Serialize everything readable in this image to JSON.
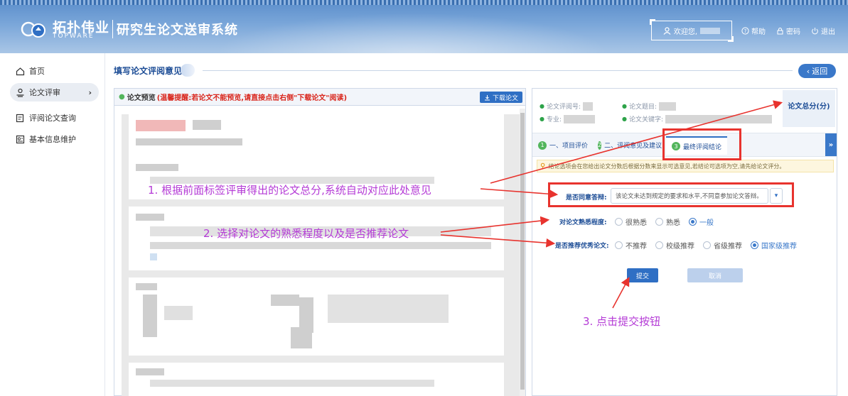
{
  "header": {
    "logo_cn": "拓扑伟业",
    "logo_en": "TOPWARE",
    "app_title": "研究生论文送审系统",
    "welcome": "欢迎您,",
    "links": [
      {
        "label": "帮助",
        "icon": "help-circle-icon"
      },
      {
        "label": "密码",
        "icon": "lock-icon"
      },
      {
        "label": "退出",
        "icon": "power-icon"
      }
    ]
  },
  "sidebar": {
    "items": [
      {
        "label": "首页",
        "icon": "home-icon"
      },
      {
        "label": "论文评审",
        "icon": "user-review-icon",
        "active": true
      },
      {
        "label": "评阅论文查询",
        "icon": "search-doc-icon"
      },
      {
        "label": "基本信息维护",
        "icon": "profile-icon"
      }
    ]
  },
  "page": {
    "title": "填写论文评阅意见",
    "back_label": "返回"
  },
  "preview": {
    "label": "论文预览",
    "warning": "(温馨提醒:若论文不能预览,请直接点击右侧\"下载论文\"阅读)",
    "download_label": "下载论文"
  },
  "info": {
    "review_no_label": "论文评阅号:",
    "thesis_title_label": "论文题目:",
    "major_label": "专业:",
    "keywords_label": "论文关键字:",
    "total_score_label": "论文总分(分)",
    "tabs": [
      {
        "num": "1",
        "label": "一、项目评价"
      },
      {
        "num": "2",
        "label": "二、评阅意见及建议"
      },
      {
        "num": "3",
        "label": "最终评阅结论",
        "active": true
      }
    ],
    "notice": "结论选项会在您给出论文分数后根据分数来显示可选意见,若结论可选项为空,请先给论文评分。",
    "agree_label": "是否同意答辩:",
    "agree_value": "该论文未达到规定的要求和水平,不同意参加论文答辩。",
    "familiarity_label": "对论文熟悉程度:",
    "familiarity_options": [
      "很熟悉",
      "熟悉",
      "一般"
    ],
    "familiarity_selected": "一般",
    "recommend_label": "是否推荐优秀论文:",
    "recommend_options": [
      "不推荐",
      "校级推荐",
      "省级推荐",
      "国家级推荐"
    ],
    "recommend_selected": "国家级推荐",
    "submit_label": "提交",
    "cancel_label": "取消"
  },
  "annotations": {
    "step1": "1. 根据前面标签评审得出的论文总分,系统自动对应此处意见",
    "step2": "2. 选择对论文的熟悉程度以及是否推荐论文",
    "step3": "3. 点击提交按钮"
  },
  "colors": {
    "primary": "#2f6fc4",
    "annotation_text": "#b43ad6",
    "annotation_box": "#e8332e"
  }
}
